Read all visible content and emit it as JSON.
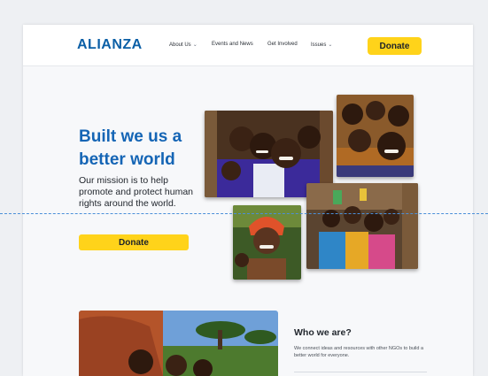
{
  "site": {
    "logo": "ALIANZA"
  },
  "nav": {
    "items": [
      {
        "label": "About Us",
        "has_dropdown": true
      },
      {
        "label": "Events and News",
        "has_dropdown": false
      },
      {
        "label": "Get Involved",
        "has_dropdown": false
      },
      {
        "label": "Issues",
        "has_dropdown": true
      }
    ],
    "donate_label": "Donate"
  },
  "hero": {
    "title": "Built we us a better world",
    "text": "Our mission is to help promote and protect human rights around the world.",
    "donate_label": "Donate"
  },
  "who": {
    "title": "Who we are?",
    "text": "We connect ideas and resources with other NGOs to build a better world for everyone."
  },
  "icons": {
    "dropdown": "chevron-down-icon"
  },
  "colors": {
    "brand": "#0b5fa6",
    "title": "#1565b5",
    "accent": "#ffd31a",
    "guide": "#4b8fd8"
  }
}
